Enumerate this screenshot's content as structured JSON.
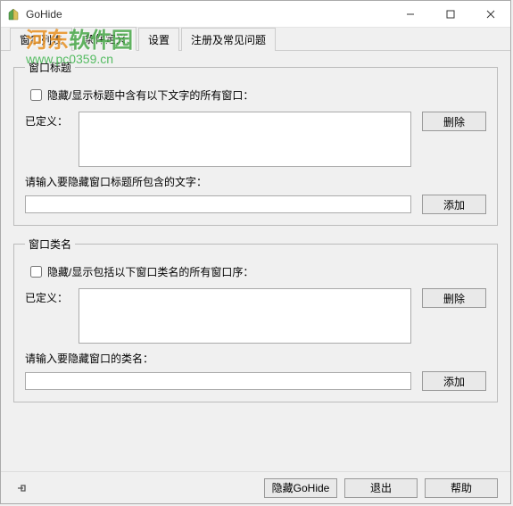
{
  "window": {
    "title": "GoHide"
  },
  "tabs": {
    "items": [
      {
        "label": "窗口列表"
      },
      {
        "label": "条件定义"
      },
      {
        "label": "设置"
      },
      {
        "label": "注册及常见问题"
      }
    ],
    "active": 1
  },
  "group_title": {
    "legend": "窗口标题",
    "checkbox_label": "隐藏/显示标题中含有以下文字的所有窗口：",
    "defined_label": "已定义：",
    "defined_value": "",
    "delete_label": "删除",
    "input_prompt": "请输入要隐藏窗口标题所包含的文字：",
    "input_value": "",
    "add_label": "添加"
  },
  "group_class": {
    "legend": "窗口类名",
    "checkbox_label": "隐藏/显示包括以下窗口类名的所有窗口序：",
    "defined_label": "已定义：",
    "defined_value": "",
    "delete_label": "删除",
    "input_prompt": "请输入要隐藏窗口的类名：",
    "input_value": "",
    "add_label": "添加"
  },
  "bottom": {
    "hide_label": "隐藏GoHide",
    "exit_label": "退出",
    "help_label": "帮助"
  },
  "watermark": {
    "line1_a": "河东",
    "line1_b": "软件园",
    "line2": "www.pc0359.cn"
  }
}
